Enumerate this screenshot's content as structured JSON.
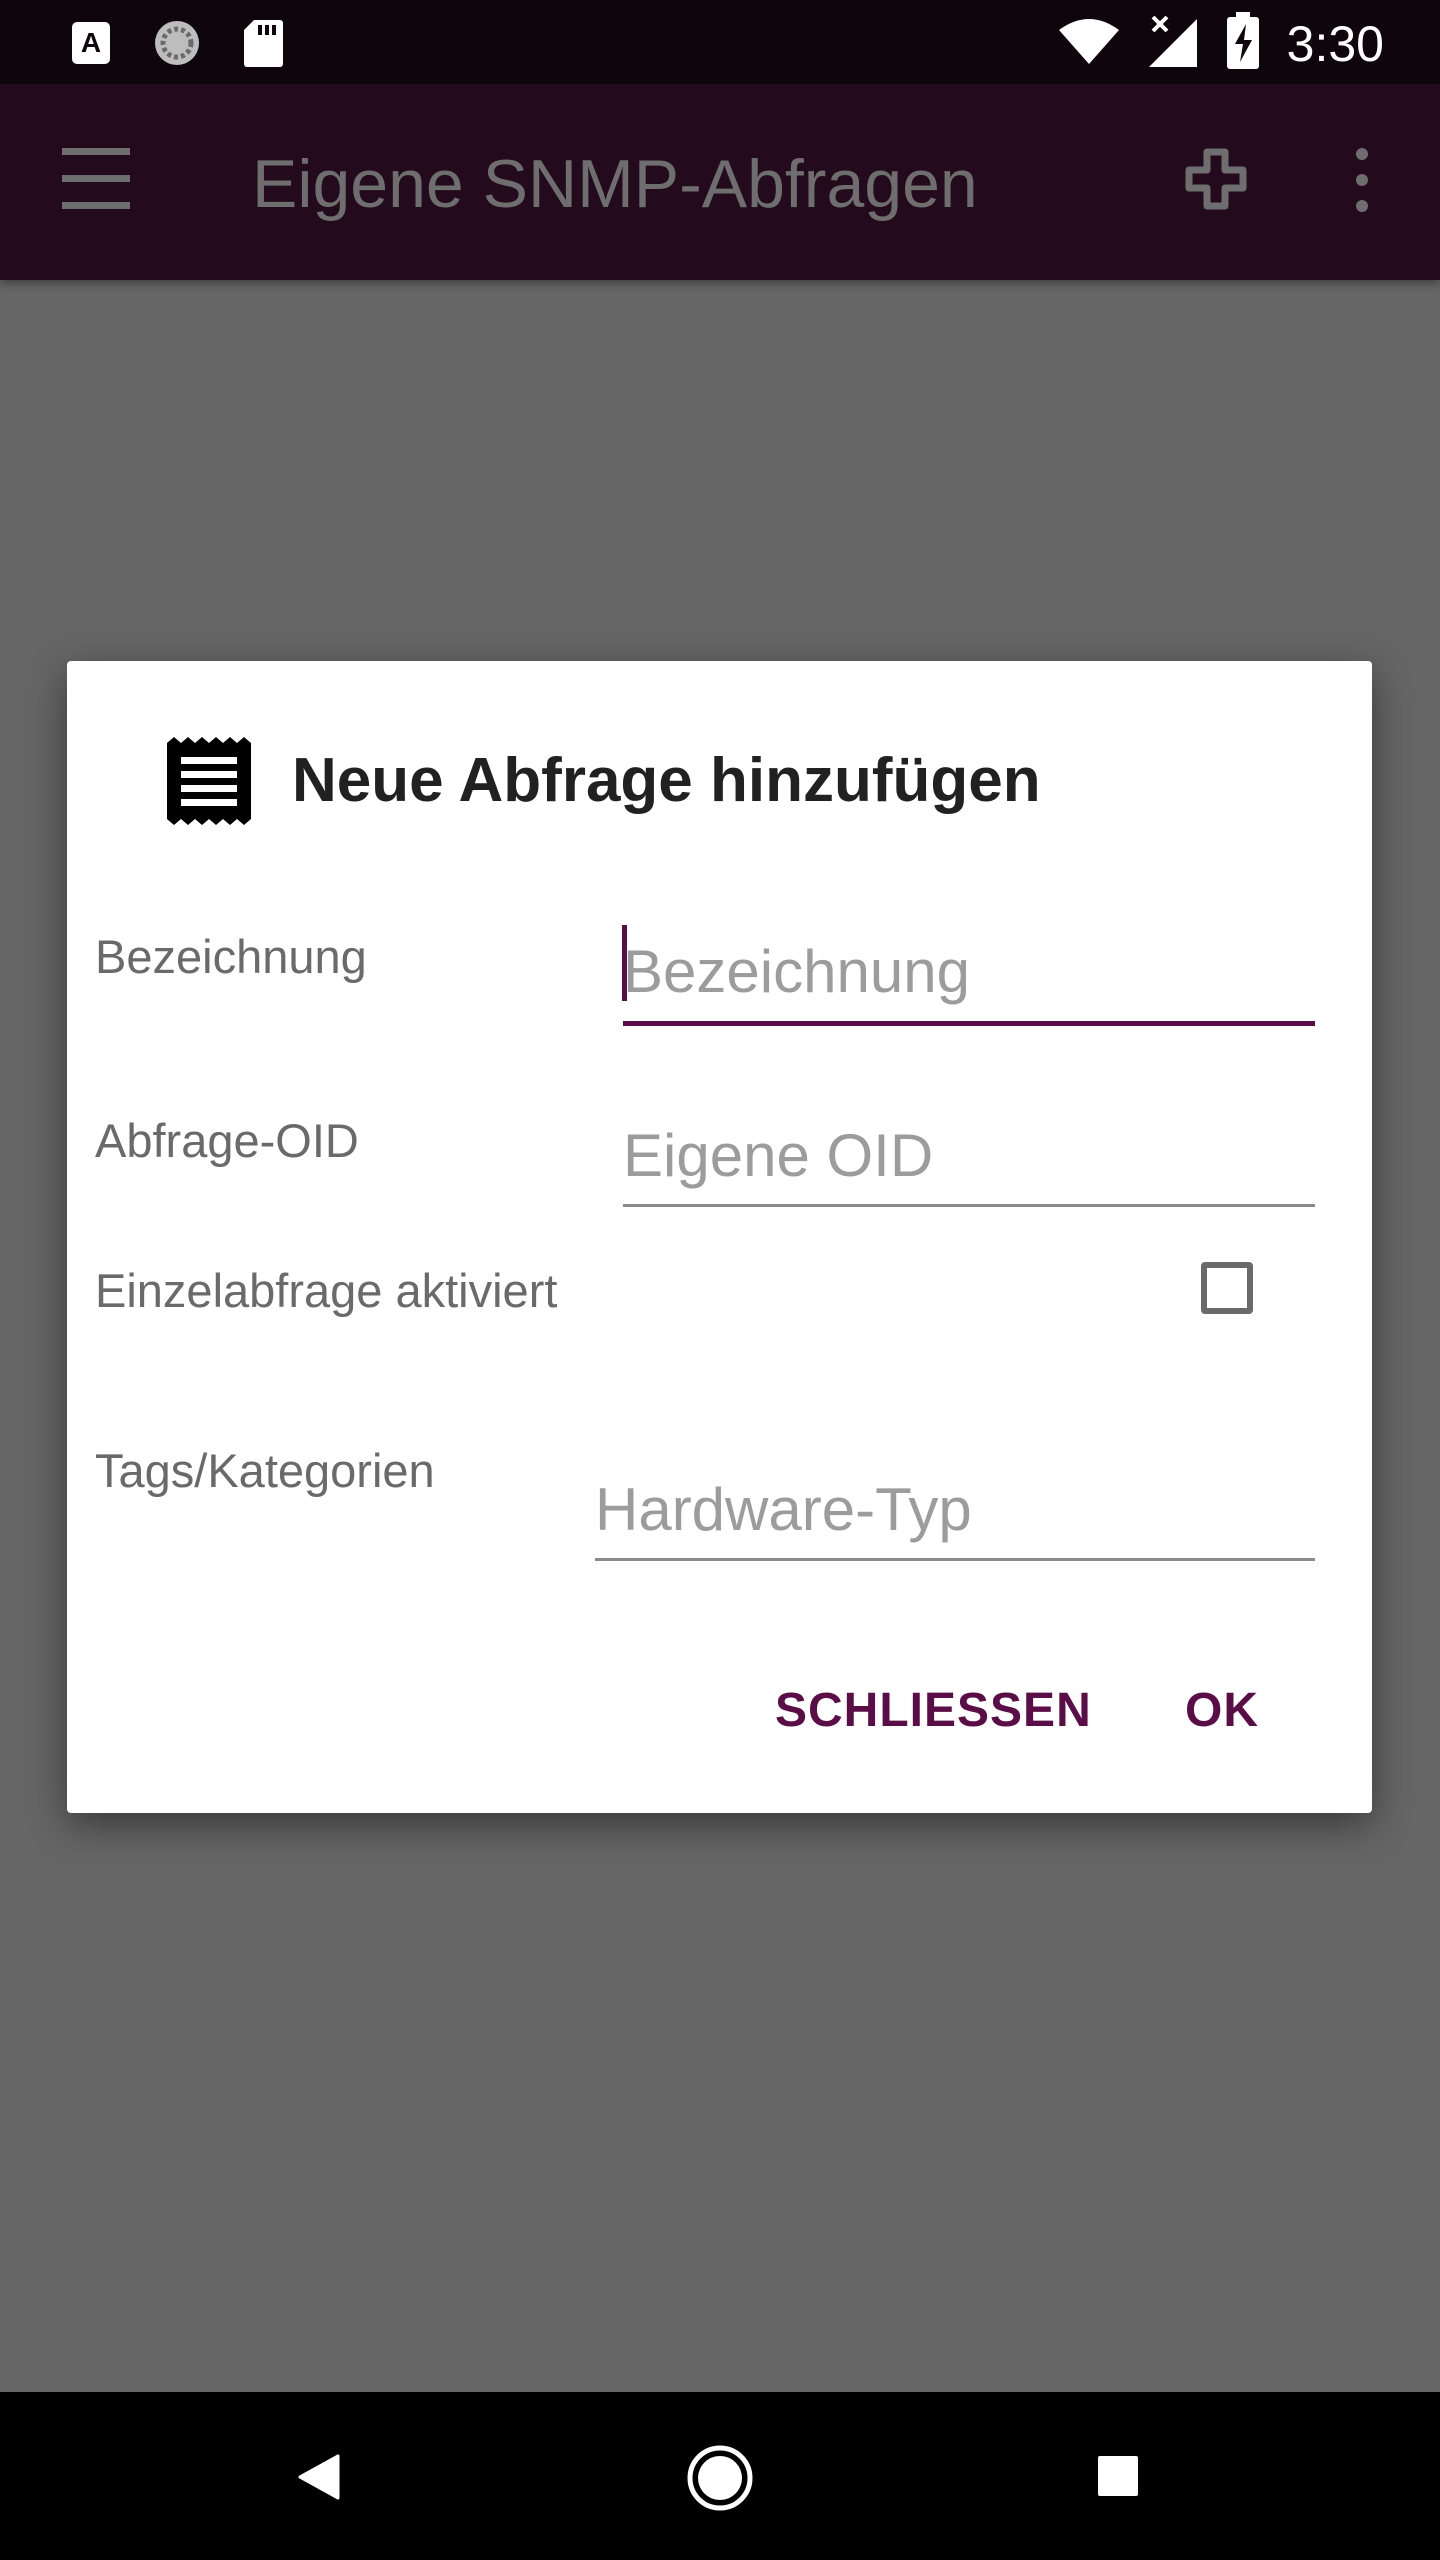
{
  "status_bar": {
    "time": "3:30",
    "left_icons": [
      "a-badge-icon",
      "sync-circle-icon",
      "sd-card-icon"
    ],
    "right_icons": [
      "wifi-icon",
      "cell-signal-icon",
      "battery-charging-icon"
    ]
  },
  "app_bar": {
    "title": "Eigene SNMP-Abfragen",
    "background": "#230a1c"
  },
  "dialog": {
    "title": "Neue Abfrage hinzufügen",
    "accent": "#5b0d47",
    "fields": {
      "name": {
        "label": "Bezeichnung",
        "value": "",
        "placeholder": "Bezeichnung"
      },
      "oid": {
        "label": "Abfrage-OID",
        "value": "",
        "placeholder": "Eigene OID"
      },
      "single": {
        "label": "Einzelabfrage aktiviert",
        "checked": false
      },
      "tags": {
        "label": "Tags/Kategorien",
        "value": "",
        "placeholder": "Hardware-Typ"
      }
    },
    "buttons": {
      "close": "SCHLIESSEN",
      "ok": "OK"
    }
  }
}
